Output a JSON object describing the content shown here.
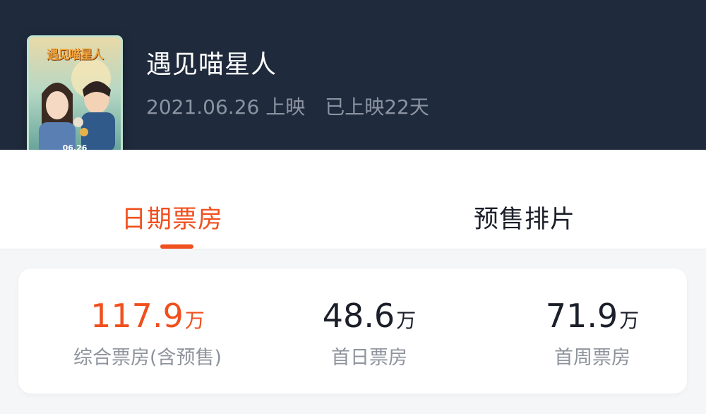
{
  "header": {
    "poster": {
      "title_art": "遇见喵星人",
      "date_art": "06.26"
    },
    "title": "遇见喵星人",
    "release_date": "2021.06.26 上映",
    "days_showing": "已上映22天"
  },
  "tabs": [
    {
      "label": "日期票房",
      "active": true
    },
    {
      "label": "预售排片",
      "active": false
    }
  ],
  "stats": [
    {
      "value": "117.9",
      "unit": "万",
      "label": "综合票房(含预售)",
      "highlight": true
    },
    {
      "value": "48.6",
      "unit": "万",
      "label": "首日票房",
      "highlight": false
    },
    {
      "value": "71.9",
      "unit": "万",
      "label": "首周票房",
      "highlight": false
    }
  ],
  "colors": {
    "header_bg": "#1f2a3c",
    "accent": "#f0501e",
    "text_dark": "#1b1f2a",
    "text_muted": "#8e939c"
  }
}
